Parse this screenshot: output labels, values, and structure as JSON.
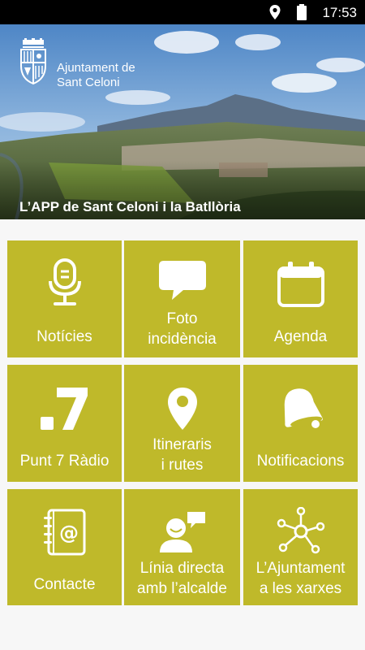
{
  "status_bar": {
    "time": "17:53"
  },
  "hero": {
    "organization": "Ajuntament de\nSant Celoni",
    "tagline": "L’APP de Sant Celoni i la Batllòria"
  },
  "menu": {
    "tiles": [
      {
        "label": "Notícies",
        "icon": "microphone-icon"
      },
      {
        "label": "Foto\nincidència",
        "icon": "speech-bubble-icon"
      },
      {
        "label": "Agenda",
        "icon": "calendar-icon"
      },
      {
        "label": "Punt 7 Ràdio",
        "icon": "punt7-logo-icon"
      },
      {
        "label": "Itineraris\ni rutes",
        "icon": "map-pin-icon"
      },
      {
        "label": "Notificacions",
        "icon": "bell-icon"
      },
      {
        "label": "Contacte",
        "icon": "address-book-icon"
      },
      {
        "label": "Línia directa\namb l’alcalde",
        "icon": "person-chat-icon"
      },
      {
        "label": "L’Ajuntament\na les xarxes",
        "icon": "network-icon"
      }
    ]
  },
  "colors": {
    "tile": "#bfb92a",
    "background": "#f7f7f7",
    "status_bar": "#000000"
  }
}
